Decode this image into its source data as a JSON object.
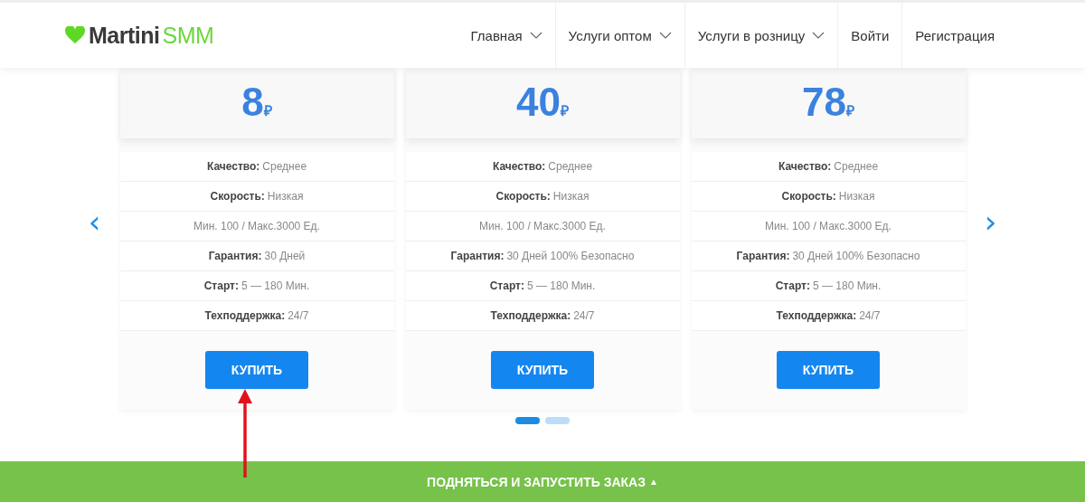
{
  "header": {
    "logo": {
      "brand": "Martini",
      "accent": "SMM"
    },
    "nav": [
      {
        "label": "Главная",
        "has_menu": true
      },
      {
        "label": "Услуги оптом",
        "has_menu": true
      },
      {
        "label": "Услуги в розницу",
        "has_menu": true
      },
      {
        "label": "Войти",
        "has_menu": false
      },
      {
        "label": "Регистрация",
        "has_menu": false
      }
    ]
  },
  "carousel": {
    "prev": "‹",
    "next": "›",
    "plans": [
      {
        "price": "8",
        "currency": "₽",
        "features": [
          "**Качество:** Среднее",
          "**Скорость:** Низкая",
          "Мин. 100 / Макс.3000 Ед.",
          "**Гарантия:** 30 Дней",
          "**Старт:** 5 — 180 Мин.",
          "**Техподдержка:** 24/7"
        ],
        "button": "КУПИТЬ"
      },
      {
        "price": "40",
        "currency": "₽",
        "features": [
          "**Качество:** Среднее",
          "**Скорость:** Низкая",
          "Мин. 100 / Макс.3000 Ед.",
          "**Гарантия:** 30 Дней 100% Безопасно",
          "**Старт:** 5 — 180 Мин.",
          "**Техподдержка:** 24/7"
        ],
        "button": "КУПИТЬ"
      },
      {
        "price": "78",
        "currency": "₽",
        "features": [
          "**Качество:** Среднее",
          "**Скорость:** Низкая",
          "Мин. 100 / Макс.3000 Ед.",
          "**Гарантия:** 30 Дней 100% Безопасно",
          "**Старт:** 5 — 180 Мин.",
          "**Техподдержка:** 24/7"
        ],
        "button": "КУПИТЬ"
      }
    ],
    "dots": [
      {
        "selected": true
      },
      {
        "selected": false
      }
    ]
  },
  "annotation": {
    "kind": "arrow",
    "color": "#e0141e"
  },
  "footer_bar": {
    "label": "ПОДНЯТЬСЯ И ЗАПУСТИТЬ ЗАКАЗ",
    "icon": "▲"
  }
}
